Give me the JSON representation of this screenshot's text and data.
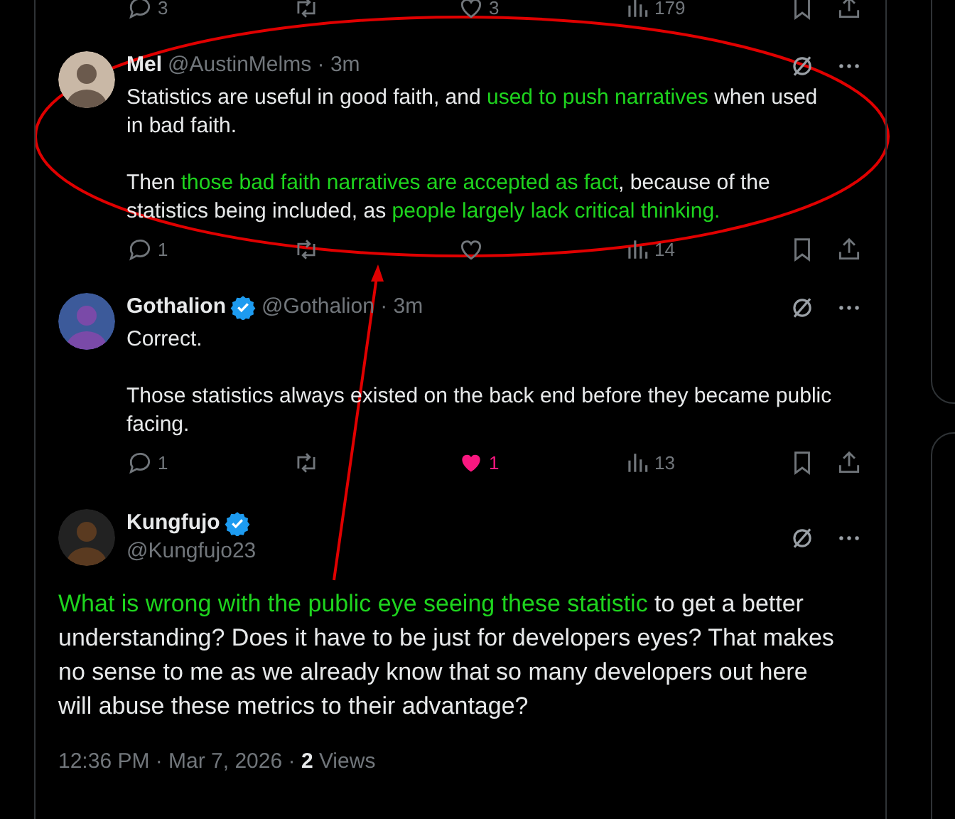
{
  "previous_tweet_actions": [
    {
      "kind": "reply",
      "count": "3",
      "active": false
    },
    {
      "kind": "repost",
      "active": false
    },
    {
      "kind": "like",
      "count": "3",
      "active": false
    },
    {
      "kind": "views",
      "count": "179",
      "active": false
    },
    {
      "kind": "bookmark",
      "active": false
    },
    {
      "kind": "share",
      "active": false
    }
  ],
  "replies": [
    {
      "name": "Mel",
      "verified": false,
      "handle": "@AustinMelms",
      "separator": "·",
      "time": "3m",
      "body": [
        [
          {
            "text": "Statistics are useful in good faith, and ",
            "highlighted": false
          },
          {
            "text": "used to push narratives",
            "highlighted": true
          },
          {
            "text": " when used in bad faith.",
            "highlighted": false
          }
        ],
        [
          {
            "text": "Then ",
            "highlighted": false
          },
          {
            "text": "those bad faith narratives are accepted as fact",
            "highlighted": true
          },
          {
            "text": ", because of the statistics being included, as ",
            "highlighted": false
          },
          {
            "text": "people largely lack critical thinking.",
            "highlighted": true
          }
        ]
      ],
      "actions": [
        {
          "kind": "reply",
          "count": "1",
          "active": false
        },
        {
          "kind": "repost",
          "active": false
        },
        {
          "kind": "like",
          "active": false
        },
        {
          "kind": "views",
          "count": "14",
          "active": false
        },
        {
          "kind": "bookmark",
          "active": false
        },
        {
          "kind": "share",
          "active": false
        }
      ]
    },
    {
      "name": "Gothalion",
      "verified": true,
      "handle": "@Gothalion",
      "separator": "·",
      "time": "3m",
      "body": [
        [
          {
            "text": "Correct.",
            "highlighted": false
          }
        ],
        [
          {
            "text": "Those statistics always existed on the back end before they became public facing.",
            "highlighted": false
          }
        ]
      ],
      "actions": [
        {
          "kind": "reply",
          "count": "1",
          "active": false
        },
        {
          "kind": "repost",
          "active": false
        },
        {
          "kind": "like",
          "count": "1",
          "active": true
        },
        {
          "kind": "views",
          "count": "13",
          "active": false
        },
        {
          "kind": "bookmark",
          "active": false
        },
        {
          "kind": "share",
          "active": false
        }
      ]
    }
  ],
  "main_tweet": {
    "name": "Kungfujo",
    "verified": true,
    "handle": "@Kungfujo23",
    "body": [
      {
        "text": "What is wrong with the public eye seeing these statistic",
        "highlighted": true
      },
      {
        "text": " to get a better understanding? Does it have to be just for developers eyes? That makes no sense to me as we already know that so many developers out here will abuse these metrics to their advantage?",
        "highlighted": false
      }
    ],
    "timestamp": "12:36 PM · Mar 7, 2026",
    "views_separator": "·",
    "views_count": "2",
    "views_label": "Views"
  }
}
